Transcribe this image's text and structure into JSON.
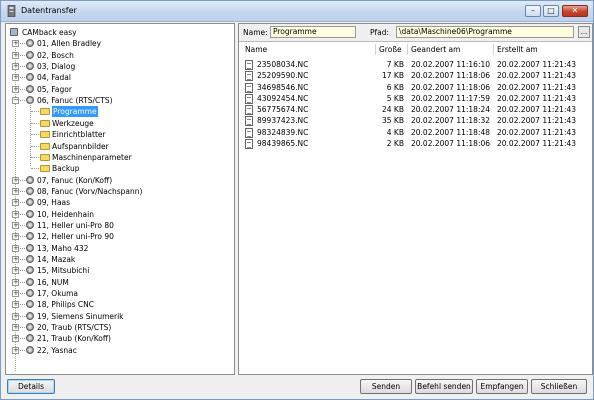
{
  "window": {
    "title": "Datentransfer"
  },
  "tree": {
    "root": "CAMback easy",
    "machines": [
      "01, Allen Bradley",
      "02, Bosch",
      "03, Dialog",
      "04, Fadal",
      "05, Fagor",
      "06, Fanuc (RTS/CTS)",
      "07, Fanuc (Kon/Koff)",
      "08, Fanuc (Vorv/Nachspann)",
      "09, Haas",
      "10, Heidenhain",
      "11, Heller uni-Pro 80",
      "12, Heller uni-Pro 90",
      "13, Maho 432",
      "14, Mazak",
      "15, Mitsubichi",
      "16, NUM",
      "17, Okuma",
      "18, Philips CNC",
      "19, Siemens Sinumerik",
      "20, Traub (RTS/CTS)",
      "21, Traub (Kon/Koff)",
      "22, Yasnac"
    ],
    "expanded_children": [
      "Programme",
      "Werkzeuge",
      "Einrichtblatter",
      "Aufspannbilder",
      "Maschinenparameter",
      "Backup"
    ],
    "selected": "Programme"
  },
  "path_bar": {
    "name_label": "Name:",
    "name_value": "Programme",
    "path_label": "Pfad:",
    "path_value": "\\data\\Maschine06\\Programme",
    "browse_label": "..."
  },
  "file_list": {
    "columns": [
      "Name",
      "Große",
      "Geandert am",
      "Erstellt am"
    ],
    "rows": [
      [
        "23508034.NC",
        "7 KB",
        "20.02.2007 11:16:10",
        "20.02.2007 11:21:43"
      ],
      [
        "25209590.NC",
        "17 KB",
        "20.02.2007 11:18:06",
        "20.02.2007 11:21:43"
      ],
      [
        "34698546.NC",
        "6 KB",
        "20.02.2007 11:18:06",
        "20.02.2007 11:21:43"
      ],
      [
        "43092454.NC",
        "5 KB",
        "20.02.2007 11:17:59",
        "20.02.2007 11:21:43"
      ],
      [
        "56775674.NC",
        "24 KB",
        "20.02.2007 11:18:24",
        "20.02.2007 11:21:43"
      ],
      [
        "89937423.NC",
        "35 KB",
        "20.02.2007 11:18:32",
        "20.02.2007 11:21:43"
      ],
      [
        "98324839.NC",
        "4 KB",
        "20.02.2007 11:18:48",
        "20.02.2007 11:21:43"
      ],
      [
        "98439865.NC",
        "2 KB",
        "20.02.2007 11:18:06",
        "20.02.2007 11:21:43"
      ]
    ]
  },
  "buttons": {
    "details": "Details",
    "senden": "Senden",
    "befehl_senden": "Befehl senden",
    "empfangen": "Empfangen",
    "schliessen": "Schließen"
  },
  "colors": {
    "selection": "#3399ff",
    "field_background": "#ffffe0",
    "close_button": "#c7442b"
  }
}
